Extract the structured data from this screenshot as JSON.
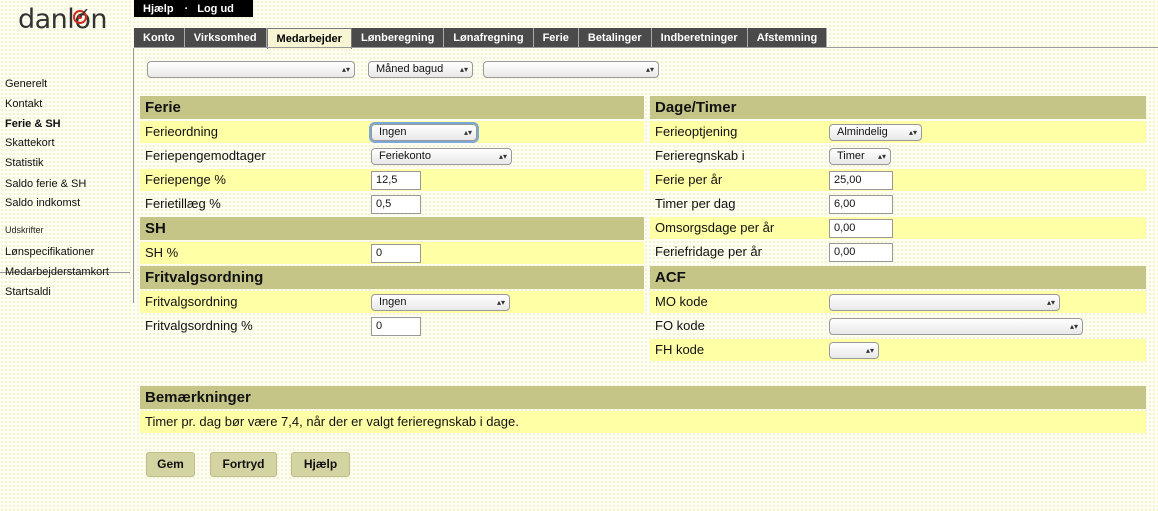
{
  "logo": {
    "text_pre": "danl",
    "text_o": "o",
    "text_post": "n",
    "accent": "#d42b1e"
  },
  "topmenu": {
    "help": "Hjælp",
    "dot": "·",
    "logout": "Log ud"
  },
  "tabs": [
    "Konto",
    "Virksomhed",
    "Medarbejder",
    "Lønberegning",
    "Lønafregning",
    "Ferie",
    "Betalinger",
    "Indberetninger",
    "Afstemning"
  ],
  "active_tab": "Medarbejder",
  "sidebar": {
    "items": [
      "Generelt",
      "Kontakt",
      "Ferie & SH",
      "Skattekort",
      "Statistik",
      "Saldo ferie & SH",
      "Saldo indkomst"
    ],
    "print_header": "Udskrifter",
    "print_items": [
      "Lønspecifikationer",
      "Medarbejderstamkort",
      "Startsaldi"
    ]
  },
  "toolbar": {
    "employee_select": "",
    "period_select": "Måned bagud",
    "third_select": ""
  },
  "ferie": {
    "title": "Ferie",
    "ferieordning_label": "Ferieordning",
    "ferieordning_value": "Ingen",
    "feriepengemodtager_label": "Feriepengemodtager",
    "feriepengemodtager_value": "Feriekonto",
    "feriepenge_label": "Feriepenge %",
    "feriepenge_value": "12,5",
    "ferietillaeg_label": "Ferietillæg %",
    "ferietillaeg_value": "0,5"
  },
  "sh": {
    "title": "SH",
    "sh_label": "SH %",
    "sh_value": "0"
  },
  "fritvalg": {
    "title": "Fritvalgsordning",
    "ordning_label": "Fritvalgsordning",
    "ordning_value": "Ingen",
    "pct_label": "Fritvalgsordning %",
    "pct_value": "0"
  },
  "dage": {
    "title": "Dage/Timer",
    "optjening_label": "Ferieoptjening",
    "optjening_value": "Almindelig",
    "regnskab_label": "Ferieregnskab i",
    "regnskab_value": "Timer",
    "ferie_aar_label": "Ferie per år",
    "ferie_aar_value": "25,00",
    "timer_dag_label": "Timer per dag",
    "timer_dag_value": "6,00",
    "omsorg_label": "Omsorgsdage per år",
    "omsorg_value": "0,00",
    "feriefri_label": "Feriefridage per år",
    "feriefri_value": "0,00"
  },
  "acf": {
    "title": "ACF",
    "mo_label": "MO kode",
    "mo_value": "",
    "fo_label": "FO kode",
    "fo_value": "",
    "fh_label": "FH kode",
    "fh_value": ""
  },
  "remarks": {
    "title": "Bemærkninger",
    "text": "Timer pr. dag bør være 7,4, når der er valgt ferieregnskab i dage."
  },
  "buttons": {
    "save": "Gem",
    "cancel": "Fortryd",
    "help": "Hjælp"
  }
}
